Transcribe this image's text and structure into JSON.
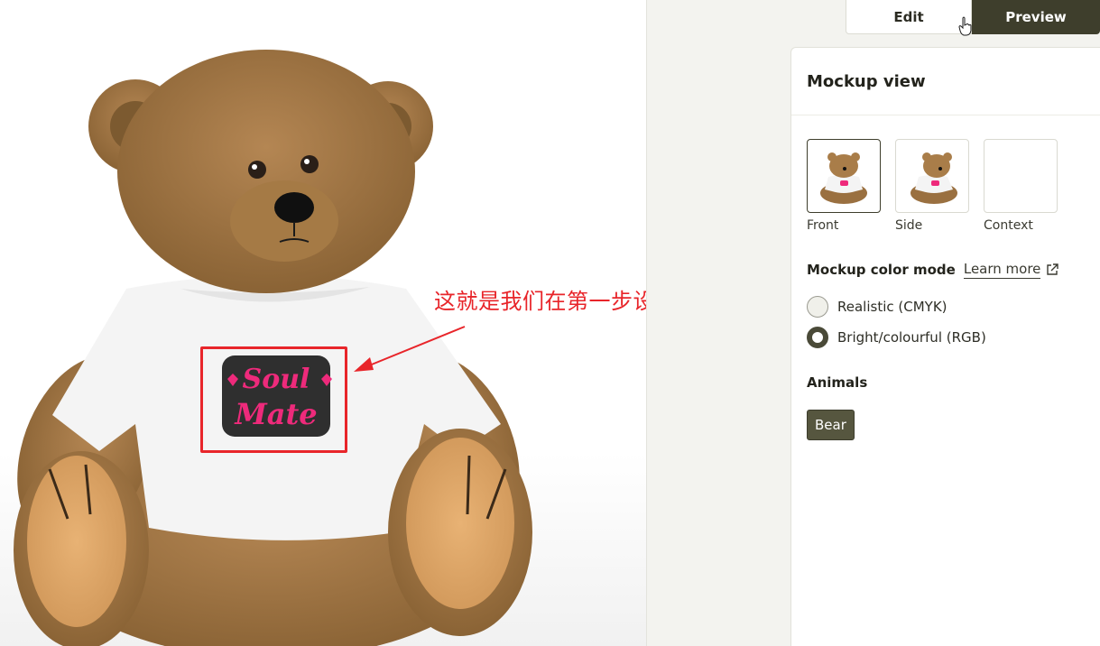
{
  "tabs": {
    "edit": "Edit",
    "preview": "Preview"
  },
  "annotation": {
    "text": "这就是我们在第一步设计好的图案"
  },
  "design": {
    "line1": "Soul",
    "line2": "Mate"
  },
  "panel": {
    "title": "Mockup view",
    "thumbnails": [
      {
        "label": "Front",
        "selected": true
      },
      {
        "label": "Side",
        "selected": false
      },
      {
        "label": "Context",
        "selected": false
      }
    ],
    "color_mode": {
      "title": "Mockup color mode",
      "learn_more": "Learn more",
      "options": [
        {
          "label": "Realistic (CMYK)",
          "checked": false
        },
        {
          "label": "Bright/colourful (RGB)",
          "checked": true
        }
      ]
    },
    "animals": {
      "title": "Animals",
      "chip": "Bear"
    }
  },
  "colors": {
    "accent": "#3e3e2c",
    "annotation": "#e8252a",
    "design_pink": "#ee2a7b"
  }
}
